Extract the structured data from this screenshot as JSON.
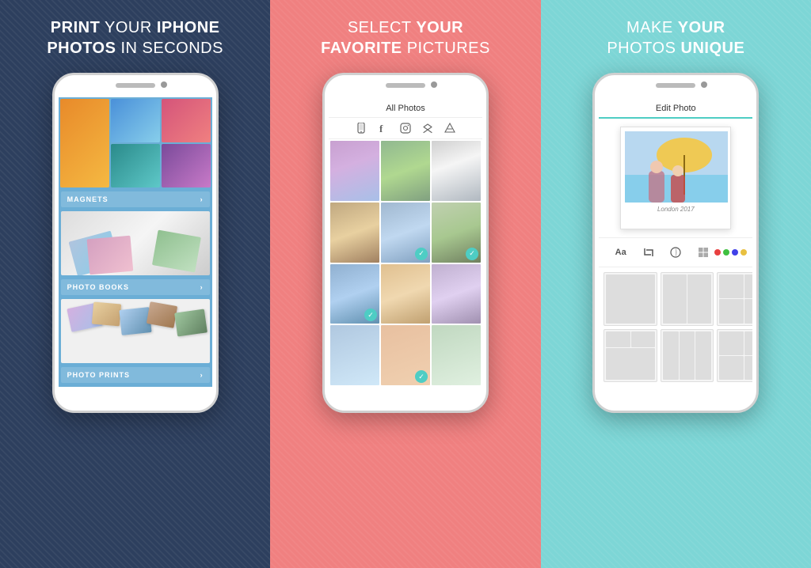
{
  "panels": [
    {
      "id": "panel-1",
      "bg_color": "#2d3f5e",
      "header_line1": "PRINT YOUR IPHONE",
      "header_line2": "PHOTOS IN SECONDS",
      "header_bold_words": [
        "PRINT",
        "IPHONE",
        "PHOTOS"
      ],
      "phone": {
        "sections": [
          {
            "label": "MAGNETS",
            "type": "magnets"
          },
          {
            "label": "PHOTO BOOKS",
            "type": "books"
          },
          {
            "label": "PHOTO PRINTS",
            "type": "prints"
          }
        ]
      }
    },
    {
      "id": "panel-2",
      "bg_color": "#f08080",
      "header_line1": "SELECT YOUR",
      "header_line2": "FAVORITE PICTURES",
      "header_bold_words": [
        "YOUR",
        "FAVORITE"
      ],
      "phone": {
        "title": "All Photos",
        "sources": [
          "phone",
          "facebook",
          "instagram",
          "dropbox",
          "google-drive"
        ]
      }
    },
    {
      "id": "panel-3",
      "bg_color": "#7dd6d6",
      "header_line1": "MAKE YOUR",
      "header_line2": "PHOTOS UNIQUE",
      "header_bold_words": [
        "YOUR",
        "UNIQUE"
      ],
      "phone": {
        "title": "Edit Photo",
        "caption": "London 2017",
        "tools": [
          "text-tool",
          "crop-tool",
          "filter-tool",
          "layout-tool",
          "color-tool"
        ]
      }
    }
  ]
}
